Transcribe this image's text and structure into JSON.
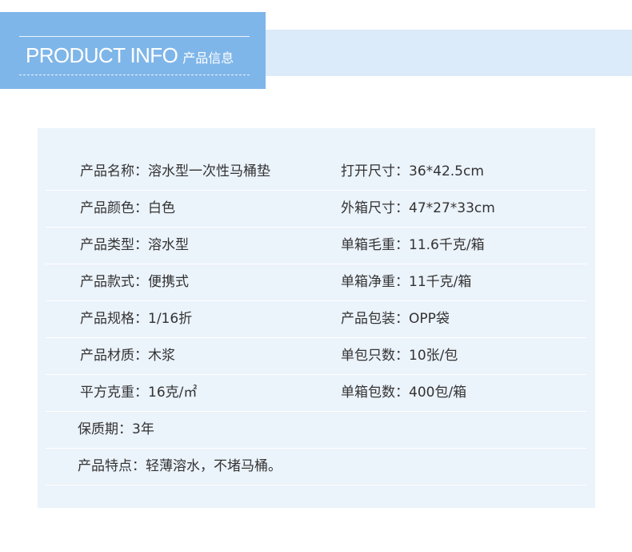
{
  "header": {
    "title_en": "PRODUCT INFO",
    "title_cn": "产品信息"
  },
  "colors": {
    "header_box": "#7fb6e9",
    "header_band": "#dcebf9",
    "table_bg": "#ebf3fb",
    "text": "#333333"
  },
  "rows": [
    {
      "left": "产品名称：溶水型一次性马桶垫",
      "right": "打开尺寸：36*42.5cm"
    },
    {
      "left": "产品颜色：白色",
      "right": "外箱尺寸：47*27*33cm"
    },
    {
      "left": "产品类型：溶水型",
      "right": "单箱毛重：11.6千克/箱"
    },
    {
      "left": "产品款式：便携式",
      "right": "单箱净重：11千克/箱"
    },
    {
      "left": "产品规格：1/16折",
      "right": "产品包装：OPP袋"
    },
    {
      "left": "产品材质：木浆",
      "right": "单包只数：10张/包"
    },
    {
      "left": "平方克重：16克/㎡",
      "right": "单箱包数：400包/箱"
    },
    {
      "left": "保质期：3年"
    },
    {
      "left": "产品特点：轻薄溶水，不堵马桶。"
    }
  ]
}
